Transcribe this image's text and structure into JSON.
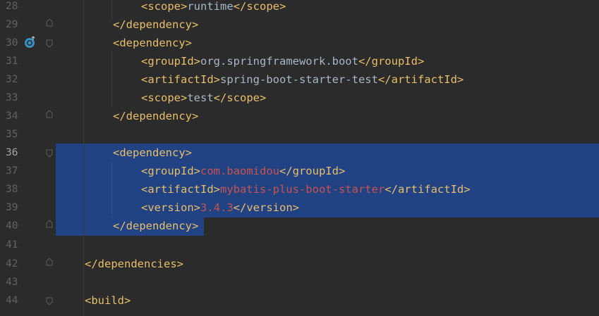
{
  "gutter": {
    "line_numbers": [
      "28",
      "29",
      "30",
      "31",
      "32",
      "33",
      "34",
      "35",
      "36",
      "37",
      "38",
      "39",
      "40",
      "41",
      "42",
      "43",
      "44"
    ],
    "current_line": "36"
  },
  "code": {
    "l28": {
      "open": "<scope>",
      "text": "runtime",
      "close": "</scope>"
    },
    "l29": {
      "close": "</dependency>"
    },
    "l30": {
      "open": "<dependency>"
    },
    "l31": {
      "open": "<groupId>",
      "text": "org.springframework.boot",
      "close": "</groupId>"
    },
    "l32": {
      "open": "<artifactId>",
      "text": "spring-boot-starter-test",
      "close": "</artifactId>"
    },
    "l33": {
      "open": "<scope>",
      "text": "test",
      "close": "</scope>"
    },
    "l34": {
      "close": "</dependency>"
    },
    "l36": {
      "open": "<dependency>"
    },
    "l37": {
      "open": "<groupId>",
      "text": "com.baomidou",
      "close": "</groupId>"
    },
    "l38": {
      "open": "<artifactId>",
      "text": "mybatis-plus-boot-starter",
      "close": "</artifactId>"
    },
    "l39": {
      "open": "<version>",
      "text": "3.4.3",
      "close": "</version>"
    },
    "l40": {
      "close": "</dependency>"
    },
    "l42": {
      "close": "</dependencies>"
    },
    "l44": {
      "open": "<build>"
    }
  },
  "colors": {
    "background": "#2b2b2b",
    "tag": "#e8bf6a",
    "text": "#a9b7c6",
    "unresolved": "#c75450",
    "selection": "#214283",
    "line_number": "#606366"
  },
  "icons": {
    "gutter_marker": "run-gutter-icon",
    "fold": "fold-marker-icon"
  }
}
